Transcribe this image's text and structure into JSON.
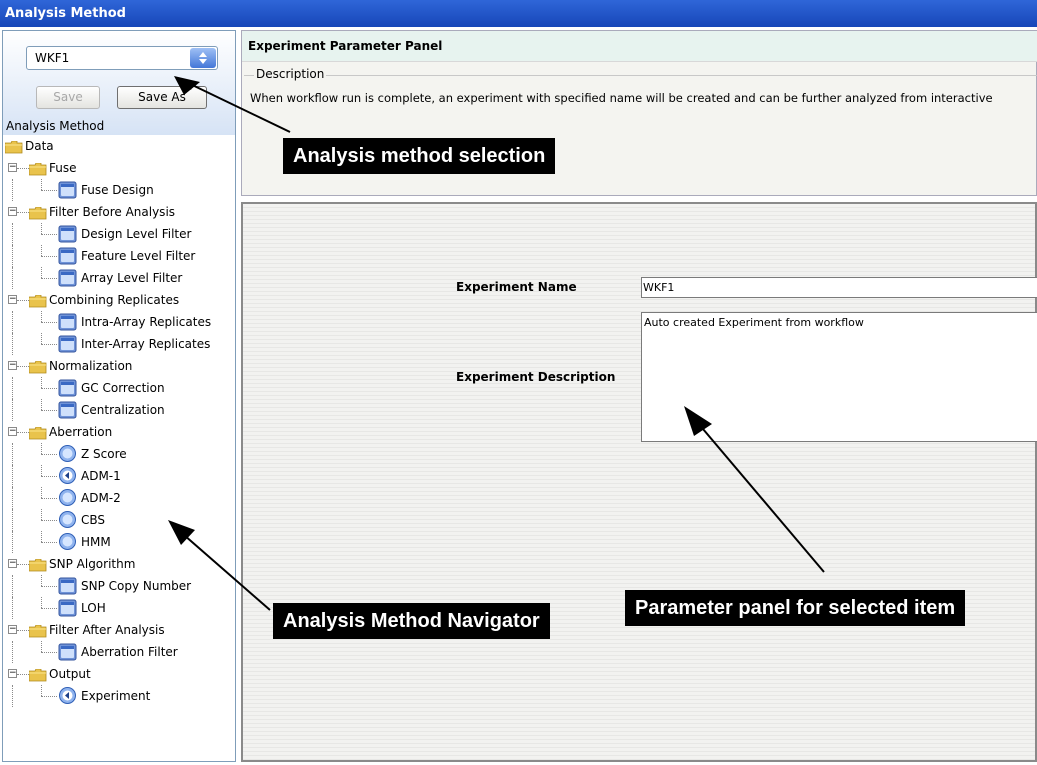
{
  "window": {
    "title": "Analysis Method"
  },
  "selector": {
    "value": "WKF1",
    "save_label": "Save",
    "save_as_label": "Save As"
  },
  "tree": {
    "header": "Analysis Method",
    "items": [
      {
        "label": "Data",
        "depth": 0,
        "icon": "folder-icon",
        "expander": false
      },
      {
        "label": "Fuse",
        "depth": 1,
        "icon": "folder-icon",
        "expander": true
      },
      {
        "label": "Fuse Design",
        "depth": 2,
        "icon": "panel-icon"
      },
      {
        "label": "Filter Before Analysis",
        "depth": 1,
        "icon": "folder-icon",
        "expander": true
      },
      {
        "label": "Design Level Filter",
        "depth": 2,
        "icon": "panel-icon"
      },
      {
        "label": "Feature Level Filter",
        "depth": 2,
        "icon": "panel-icon"
      },
      {
        "label": "Array Level Filter",
        "depth": 2,
        "icon": "panel-icon"
      },
      {
        "label": "Combining Replicates",
        "depth": 1,
        "icon": "folder-icon",
        "expander": true
      },
      {
        "label": "Intra-Array Replicates",
        "depth": 2,
        "icon": "panel-icon"
      },
      {
        "label": "Inter-Array Replicates",
        "depth": 2,
        "icon": "panel-icon"
      },
      {
        "label": "Normalization",
        "depth": 1,
        "icon": "folder-icon",
        "expander": true
      },
      {
        "label": "GC Correction",
        "depth": 2,
        "icon": "panel-icon"
      },
      {
        "label": "Centralization",
        "depth": 2,
        "icon": "panel-icon"
      },
      {
        "label": "Aberration",
        "depth": 1,
        "icon": "folder-icon",
        "expander": true
      },
      {
        "label": "Z Score",
        "depth": 2,
        "icon": "circle-icon"
      },
      {
        "label": "ADM-1",
        "depth": 2,
        "icon": "circle-selected-icon"
      },
      {
        "label": "ADM-2",
        "depth": 2,
        "icon": "circle-icon"
      },
      {
        "label": "CBS",
        "depth": 2,
        "icon": "circle-icon"
      },
      {
        "label": "HMM",
        "depth": 2,
        "icon": "circle-icon"
      },
      {
        "label": "SNP Algorithm",
        "depth": 1,
        "icon": "folder-icon",
        "expander": true
      },
      {
        "label": "SNP Copy Number",
        "depth": 2,
        "icon": "panel-icon"
      },
      {
        "label": "LOH",
        "depth": 2,
        "icon": "panel-icon"
      },
      {
        "label": "Filter After Analysis",
        "depth": 1,
        "icon": "folder-icon",
        "expander": true
      },
      {
        "label": "Aberration Filter",
        "depth": 2,
        "icon": "panel-icon"
      },
      {
        "label": "Output",
        "depth": 1,
        "icon": "folder-icon",
        "expander": true
      },
      {
        "label": "Experiment",
        "depth": 2,
        "icon": "circle-selected-icon"
      }
    ]
  },
  "panel": {
    "title": "Experiment Parameter Panel",
    "description_legend": "Description",
    "description_text": "When workflow run is complete, an experiment with specified name will be created and can be further analyzed from interactive",
    "experiment_name_label": "Experiment Name",
    "experiment_name_value": "WKF1",
    "experiment_description_label": "Experiment Description",
    "experiment_description_value": "Auto created Experiment from workflow"
  },
  "callouts": {
    "selection": "Analysis method selection",
    "navigator": "Analysis Method Navigator",
    "parameter": "Parameter panel for selected item"
  },
  "colors": {
    "titlebar": "#1f54c8",
    "panel_title_bg": "#e7f3ef",
    "callout_bg": "#000000"
  }
}
